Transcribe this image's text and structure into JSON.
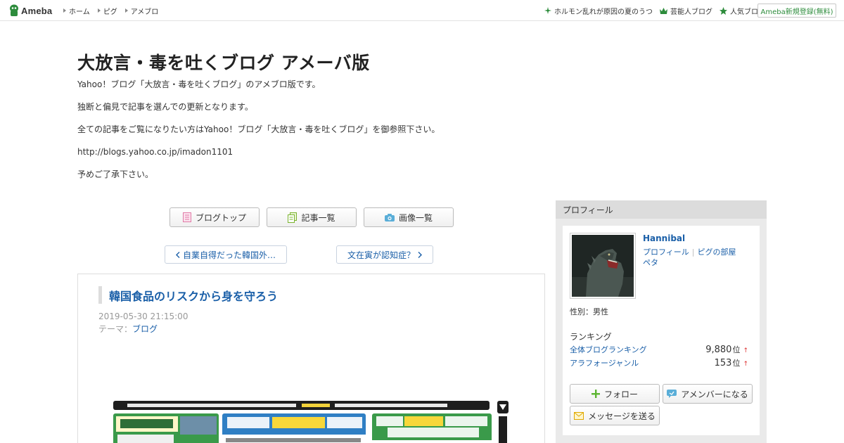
{
  "global_header": {
    "logo_text": "Ameba",
    "nav": [
      "ホーム",
      "ピグ",
      "アメブロ"
    ],
    "right_links": [
      {
        "icon": "sparkle-icon",
        "label": "ホルモン乱れが原因の夏のうつ"
      },
      {
        "icon": "crown-icon",
        "label": "芸能人ブログ"
      },
      {
        "icon": "star-icon",
        "label": "人気ブログ"
      }
    ],
    "register_label": "Ameba新規登録(無料)"
  },
  "blog": {
    "title": "大放言・毒を吐くブログ アメーバ版",
    "description": [
      "Yahoo！ブログ「大放言・毒を吐くブログ」のアメブロ版です。",
      "独断と偏見で記事を選んでの更新となります。",
      "全ての記事をご覧になりたい方はYahoo！ブログ「大放言・毒を吐くブログ」を御参照下さい。",
      "http://blogs.yahoo.co.jp/imadon1101",
      "予めご了承下さい。"
    ]
  },
  "nav_buttons": {
    "top": "ブログトップ",
    "entries": "記事一覧",
    "images": "画像一覧"
  },
  "pager": {
    "prev": "自業自得だった韓国外…",
    "next": "文在寅が認知症？"
  },
  "entry": {
    "title": "韓国食品のリスクから身を守ろう",
    "date": "2019-05-30 21:15:00",
    "theme_label": "テーマ：",
    "theme": "ブログ"
  },
  "sidebar": {
    "heading": "プロフィール",
    "name": "Hannibal",
    "links": [
      "プロフィール",
      "ピグの部屋",
      "ペタ"
    ],
    "gender": "性別：男性",
    "ranking_title": "ランキング",
    "rankings": [
      {
        "label": "全体ブログランキング",
        "value": "9,880",
        "unit": "位",
        "trend": "↑"
      },
      {
        "label": "アラフォージャンル",
        "value": "153",
        "unit": "位",
        "trend": "↑"
      }
    ],
    "follow": "フォロー",
    "amember": "アメンバーになる",
    "message": "メッセージを送る"
  },
  "colors": {
    "link": "#1a5fa8",
    "ameba_green": "#2d8c3c",
    "trend_up": "#dd3333"
  }
}
